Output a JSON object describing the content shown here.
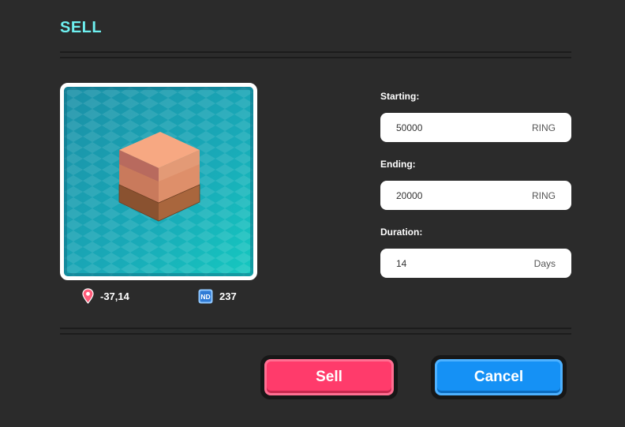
{
  "dialog": {
    "title": "SELL"
  },
  "parcel": {
    "coordinates": "-37,14",
    "count": "237",
    "location_icon": "location-pin-icon",
    "count_icon": "nd-badge-icon"
  },
  "form": {
    "starting": {
      "label": "Starting:",
      "value": "50000",
      "unit": "RING"
    },
    "ending": {
      "label": "Ending:",
      "value": "20000",
      "unit": "RING"
    },
    "duration": {
      "label": "Duration:",
      "value": "14",
      "unit": "Days"
    }
  },
  "actions": {
    "sell_label": "Sell",
    "cancel_label": "Cancel"
  },
  "colors": {
    "title": "#6ef0f0",
    "sell": "#ff3b6b",
    "cancel": "#1591f5",
    "background": "#2b2b2b",
    "tile": "#1fb5c2"
  }
}
